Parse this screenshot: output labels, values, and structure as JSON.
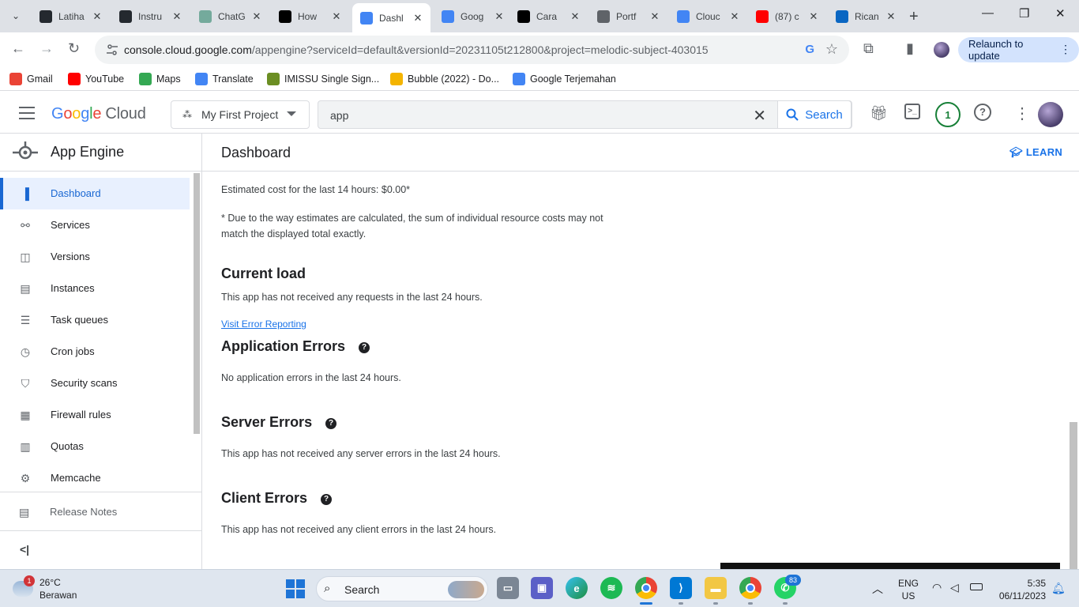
{
  "browser": {
    "tabs": [
      {
        "title": "Latiha",
        "icon": "github-icon",
        "color": "#24292f"
      },
      {
        "title": "Instru",
        "icon": "github-icon",
        "color": "#24292f"
      },
      {
        "title": "ChatG",
        "icon": "chatgpt-icon",
        "color": "#74aa9c"
      },
      {
        "title": "How",
        "icon": "medium-icon",
        "color": "#000000"
      },
      {
        "title": "Dashl",
        "icon": "app-engine-icon",
        "color": "#4285f4",
        "active": true
      },
      {
        "title": "Goog",
        "icon": "google-cloud-icon",
        "color": "#4285f4"
      },
      {
        "title": "Cara",
        "icon": "medium-icon",
        "color": "#000000"
      },
      {
        "title": "Portf",
        "icon": "globe-icon",
        "color": "#5f6368"
      },
      {
        "title": "Clouc",
        "icon": "google-cloud-icon",
        "color": "#4285f4"
      },
      {
        "title": "(87) c",
        "icon": "youtube-icon",
        "color": "#ff0000"
      },
      {
        "title": "Rican",
        "icon": "linkedin-icon",
        "color": "#0a66c2"
      }
    ],
    "url_host": "console.cloud.google.com",
    "url_path": "/appengine?serviceId=default&versionId=20231105t212800&project=melodic-subject-403015",
    "relaunch_label": "Relaunch to update",
    "bookmarks": [
      {
        "label": "Gmail",
        "icon": "gmail-icon",
        "color": "#ea4335"
      },
      {
        "label": "YouTube",
        "icon": "youtube-icon",
        "color": "#ff0000"
      },
      {
        "label": "Maps",
        "icon": "maps-icon",
        "color": "#34a853"
      },
      {
        "label": "Translate",
        "icon": "translate-icon",
        "color": "#4285f4"
      },
      {
        "label": "IMISSU Single Sign...",
        "icon": "university-seal-icon",
        "color": "#6b8e23"
      },
      {
        "label": "Bubble (2022) - Do...",
        "icon": "bubble-icon",
        "color": "#f4b400"
      },
      {
        "label": "Google Terjemahan",
        "icon": "translate-icon",
        "color": "#4285f4"
      }
    ]
  },
  "gcp": {
    "logo_google": "Google",
    "logo_cloud": "Cloud",
    "project": "My First Project",
    "search_value": "app",
    "search_label": "Search",
    "notifications": "1"
  },
  "sidebar": {
    "product": "App Engine",
    "items": [
      {
        "label": "Dashboard",
        "icon": "dashboard-icon",
        "active": true
      },
      {
        "label": "Services",
        "icon": "services-icon"
      },
      {
        "label": "Versions",
        "icon": "versions-icon"
      },
      {
        "label": "Instances",
        "icon": "instances-icon"
      },
      {
        "label": "Task queues",
        "icon": "task-queues-icon"
      },
      {
        "label": "Cron jobs",
        "icon": "cron-icon"
      },
      {
        "label": "Security scans",
        "icon": "shield-icon"
      },
      {
        "label": "Firewall rules",
        "icon": "firewall-icon"
      },
      {
        "label": "Quotas",
        "icon": "quotas-icon"
      },
      {
        "label": "Memcache",
        "icon": "memcache-icon"
      }
    ],
    "release_notes": "Release Notes"
  },
  "main": {
    "title": "Dashboard",
    "learn": "LEARN",
    "estimated_cost": "Estimated cost for the last 14 hours: $0.00*",
    "disclaimer_1": "* Due to the way estimates are calculated, the sum of individual resource costs may not",
    "disclaimer_2": "match the displayed total exactly.",
    "current_load_title": "Current load",
    "current_load_text": "This app has not received any requests in the last 24 hours.",
    "error_reporting_link": "Visit Error Reporting",
    "app_errors_title": "Application Errors",
    "app_errors_text": "No application errors in the last 24 hours.",
    "server_errors_title": "Server Errors",
    "server_errors_text": "This app has not received any server errors in the last 24 hours.",
    "client_errors_title": "Client Errors",
    "client_errors_text": "This app has not received any client errors in the last 24 hours."
  },
  "taskbar": {
    "weather_temp": "26°C",
    "weather_cond": "Berawan",
    "weather_badge": "1",
    "search_label": "Search",
    "whatsapp_badge": "83",
    "lang_1": "ENG",
    "lang_2": "US",
    "time": "5:35",
    "date": "06/11/2023"
  }
}
